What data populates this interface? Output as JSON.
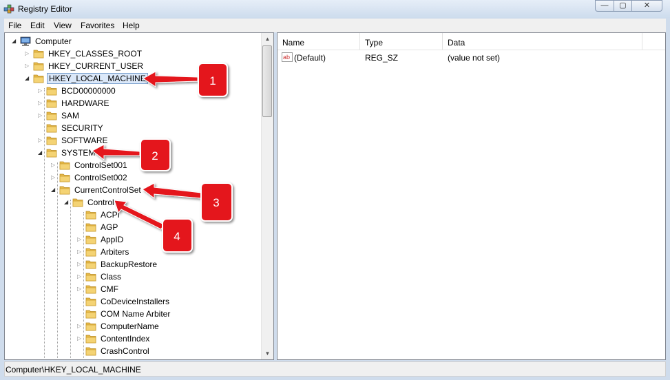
{
  "window": {
    "title": "Registry Editor",
    "minimize": "—",
    "maximize": "▢",
    "close": "✕"
  },
  "menu": [
    "File",
    "Edit",
    "View",
    "Favorites",
    "Help"
  ],
  "tree": [
    {
      "label": "Computer",
      "level": 0,
      "exp": "open",
      "icon": "computer-icon"
    },
    {
      "label": "HKEY_CLASSES_ROOT",
      "level": 1,
      "exp": "closed"
    },
    {
      "label": "HKEY_CURRENT_USER",
      "level": 1,
      "exp": "closed"
    },
    {
      "label": "HKEY_LOCAL_MACHINE",
      "level": 1,
      "exp": "open",
      "selected": true
    },
    {
      "label": "BCD00000000",
      "level": 2,
      "exp": "closed"
    },
    {
      "label": "HARDWARE",
      "level": 2,
      "exp": "closed"
    },
    {
      "label": "SAM",
      "level": 2,
      "exp": "closed"
    },
    {
      "label": "SECURITY",
      "level": 2,
      "exp": "none"
    },
    {
      "label": "SOFTWARE",
      "level": 2,
      "exp": "closed"
    },
    {
      "label": "SYSTEM",
      "level": 2,
      "exp": "open"
    },
    {
      "label": "ControlSet001",
      "level": 3,
      "exp": "closed"
    },
    {
      "label": "ControlSet002",
      "level": 3,
      "exp": "closed"
    },
    {
      "label": "CurrentControlSet",
      "level": 3,
      "exp": "open"
    },
    {
      "label": "Control",
      "level": 4,
      "exp": "open"
    },
    {
      "label": "ACPI",
      "level": 5,
      "exp": "none"
    },
    {
      "label": "AGP",
      "level": 5,
      "exp": "none"
    },
    {
      "label": "AppID",
      "level": 5,
      "exp": "closed"
    },
    {
      "label": "Arbiters",
      "level": 5,
      "exp": "closed"
    },
    {
      "label": "BackupRestore",
      "level": 5,
      "exp": "closed"
    },
    {
      "label": "Class",
      "level": 5,
      "exp": "closed"
    },
    {
      "label": "CMF",
      "level": 5,
      "exp": "closed"
    },
    {
      "label": "CoDeviceInstallers",
      "level": 5,
      "exp": "none"
    },
    {
      "label": "COM Name Arbiter",
      "level": 5,
      "exp": "none"
    },
    {
      "label": "ComputerName",
      "level": 5,
      "exp": "closed"
    },
    {
      "label": "ContentIndex",
      "level": 5,
      "exp": "closed"
    },
    {
      "label": "CrashControl",
      "level": 5,
      "exp": "none"
    }
  ],
  "list": {
    "columns": [
      "Name",
      "Type",
      "Data"
    ],
    "rows": [
      {
        "name": "(Default)",
        "type": "REG_SZ",
        "data": "(value not set)",
        "icon": "string-value-icon"
      }
    ]
  },
  "status": "Computer\\HKEY_LOCAL_MACHINE",
  "callouts": [
    "1",
    "2",
    "3",
    "4"
  ],
  "colors": {
    "callout": "#e4131c",
    "selection": "#dbe8f9",
    "folder": "#f4d374"
  }
}
